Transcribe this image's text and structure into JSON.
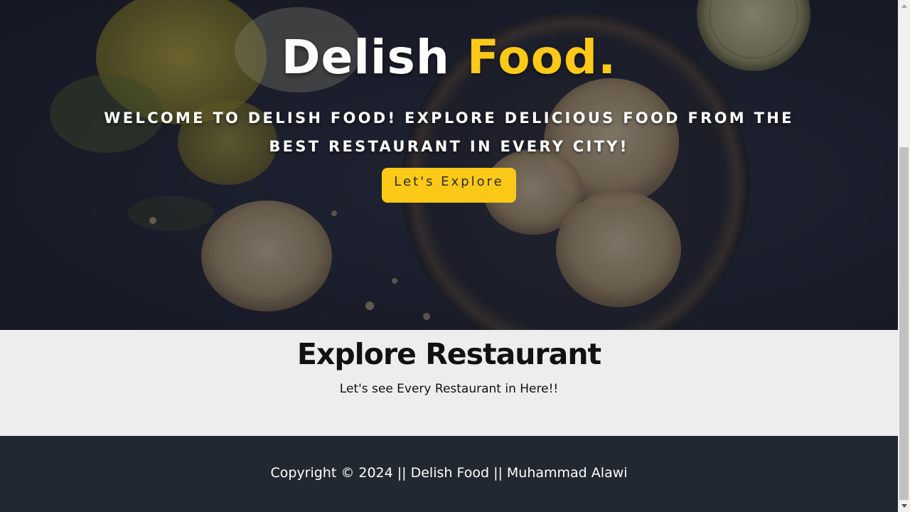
{
  "hero": {
    "title_main": "Delish ",
    "title_accent": "Food.",
    "subtitle": "Welcome to Delish Food! Explore delicious food from the best restaurant in every city!",
    "cta_label": "Let's Explore"
  },
  "explore": {
    "title": "Explore Restaurant",
    "subtitle": "Let's see Every Restaurant in Here!!"
  },
  "footer": {
    "copyright": "Copyright © 2024 || Delish Food || Muhammad Alawi"
  },
  "colors": {
    "accent": "#fcc918",
    "hero_bg": "#1f2230",
    "section_bg": "#ededed",
    "footer_bg": "#222831"
  },
  "icons": {
    "scroll_up": "triangle-up-icon",
    "scroll_down": "triangle-down-icon"
  }
}
